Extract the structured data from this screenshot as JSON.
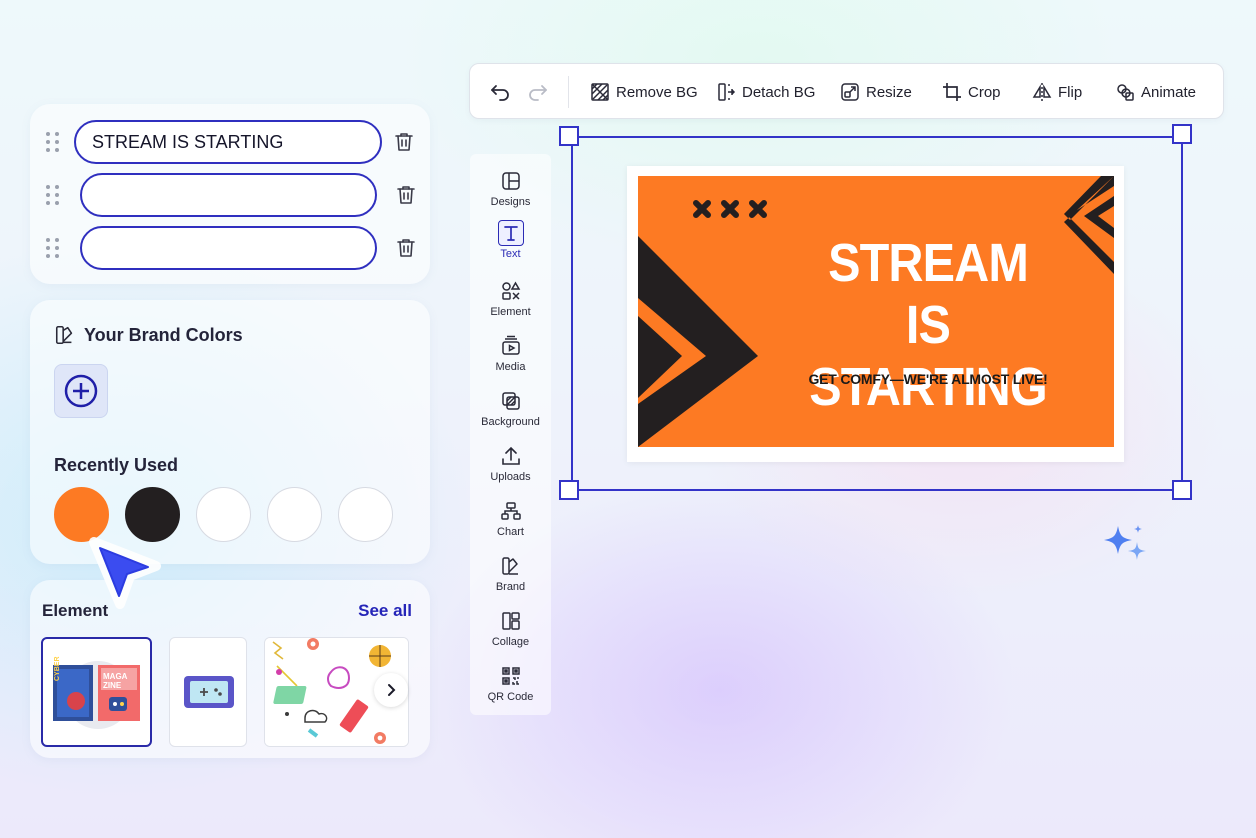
{
  "text_fields": [
    {
      "value": "STREAM IS STARTING"
    },
    {
      "value": ""
    },
    {
      "value": ""
    }
  ],
  "brand": {
    "title": "Your Brand Colors",
    "recent_title": "Recently Used",
    "recent_colors": [
      "#fd7a23",
      "#231f20",
      "#ffffff",
      "#ffffff",
      "#ffffff"
    ]
  },
  "elements": {
    "title": "Element",
    "see_all": "See all"
  },
  "toolbar": {
    "remove_bg": "Remove BG",
    "detach_bg": "Detach BG",
    "resize": "Resize",
    "crop": "Crop",
    "flip": "Flip",
    "animate": "Animate"
  },
  "sidenav": {
    "items": [
      {
        "label": "Designs",
        "icon": "layout-icon"
      },
      {
        "label": "Text",
        "icon": "text-icon"
      },
      {
        "label": "Element",
        "icon": "shapes-icon"
      },
      {
        "label": "Media",
        "icon": "media-icon"
      },
      {
        "label": "Background",
        "icon": "background-icon"
      },
      {
        "label": "Uploads",
        "icon": "upload-icon"
      },
      {
        "label": "Chart",
        "icon": "chart-icon"
      },
      {
        "label": "Brand",
        "icon": "brand-icon"
      },
      {
        "label": "Collage",
        "icon": "collage-icon"
      },
      {
        "label": "QR Code",
        "icon": "qr-code-icon"
      }
    ],
    "active": "Text"
  },
  "canvas": {
    "title_line1": "STREAM",
    "title_line2": "IS STARTING",
    "subtitle": "GET COMFY—WE'RE ALMOST LIVE!",
    "background_color": "#fd7a23",
    "accent_color": "#231f20"
  },
  "thumbs": {
    "magazine_left": "CYBER TECH",
    "magazine_right": "MAGA ZINE"
  },
  "colors": {
    "selection": "#3333c8",
    "brand_accent": "#2525b8"
  }
}
